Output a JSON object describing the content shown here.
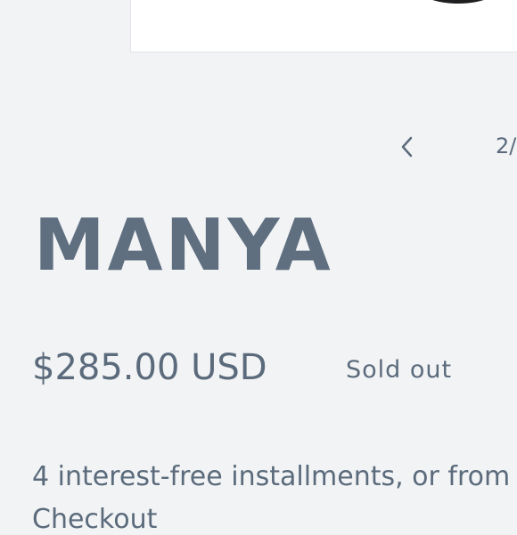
{
  "gallery": {
    "counter": "2/",
    "prev_icon": "chevron-left-icon"
  },
  "product": {
    "title": "MANYA",
    "price": "$285.00 USD",
    "badge": "Sold out"
  },
  "installments": {
    "line1": "4 interest-free installments, or from",
    "line2": "Checkout"
  },
  "colors": {
    "background": "#f2f3f5",
    "text": "#5b6b7c",
    "title": "#5f6f80"
  }
}
